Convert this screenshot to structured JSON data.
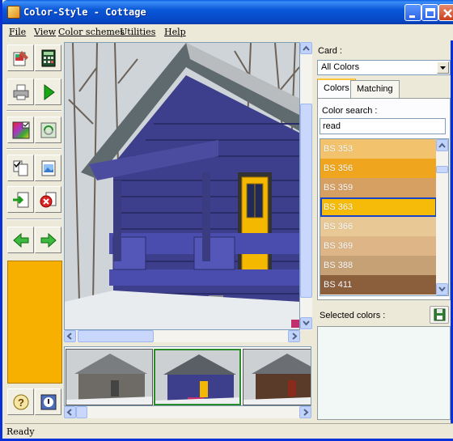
{
  "window": {
    "title": "Color-Style - Cottage"
  },
  "menu": [
    {
      "label": "File"
    },
    {
      "label": "View"
    },
    {
      "label": "Color schemes"
    },
    {
      "label": "Utilities"
    },
    {
      "label": "Help"
    }
  ],
  "current_color": "#F7AF00",
  "right_panel": {
    "card_label": "Card :",
    "card_value": "All Colors",
    "tabs": [
      {
        "label": "Colors"
      },
      {
        "label": "Matching"
      }
    ],
    "search_label": "Color search :",
    "search_value": "read",
    "colors": [
      {
        "name": "BS 353",
        "hex": "#F2C36C"
      },
      {
        "name": "BS 356",
        "hex": "#EFA61E"
      },
      {
        "name": "BS 359",
        "hex": "#D7A063"
      },
      {
        "name": "BS 363",
        "hex": "#F6BB09"
      },
      {
        "name": "BS 366",
        "hex": "#E8C995"
      },
      {
        "name": "BS 369",
        "hex": "#DDB586"
      },
      {
        "name": "BS 388",
        "hex": "#C6A176"
      },
      {
        "name": "BS 411",
        "hex": "#8B5E3C"
      }
    ],
    "selected_color_index": 3,
    "selected_colors_label": "Selected colors :"
  },
  "status": {
    "text": "Ready"
  }
}
